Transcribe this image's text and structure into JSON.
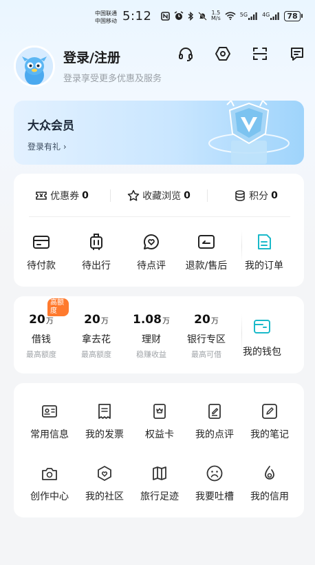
{
  "status_bar": {
    "carrier_1": "中国联通",
    "carrier_2": "中国移动",
    "time": "5:12",
    "net_speed_value": "1.5",
    "net_speed_unit": "M/s",
    "signal_1": "5G",
    "signal_2": "4G",
    "battery": "78"
  },
  "profile": {
    "title": "登录/注册",
    "subtitle": "登录享受更多优惠及服务"
  },
  "top_icons": [
    "headset-icon",
    "settings-hexagon-icon",
    "scan-icon",
    "message-icon"
  ],
  "member": {
    "title": "大众会员",
    "link": "登录有礼 ›"
  },
  "stats": [
    {
      "icon": "coupon-icon",
      "label": "优惠券",
      "count": "0"
    },
    {
      "icon": "star-icon",
      "label": "收藏浏览",
      "count": "0"
    },
    {
      "icon": "coins-icon",
      "label": "积分",
      "count": "0"
    }
  ],
  "orders": [
    {
      "icon": "wallet-card-icon",
      "label": "待付款"
    },
    {
      "icon": "luggage-icon",
      "label": "待出行"
    },
    {
      "icon": "review-heart-icon",
      "label": "待点评"
    },
    {
      "icon": "refund-icon",
      "label": "退款/售后"
    },
    {
      "icon": "order-doc-icon",
      "label": "我的订单"
    }
  ],
  "finance": {
    "badge": "高额度",
    "items": [
      {
        "amount": "20",
        "unit": "万",
        "name": "借钱",
        "sub": "最高额度"
      },
      {
        "amount": "20",
        "unit": "万",
        "name": "拿去花",
        "sub": "最高额度"
      },
      {
        "amount": "1.08",
        "unit": "万",
        "name": "理财",
        "sub": "稳赚收益"
      },
      {
        "amount": "20",
        "unit": "万",
        "name": "银行专区",
        "sub": "最高可借"
      }
    ],
    "wallet_label": "我的钱包"
  },
  "services": [
    {
      "icon": "id-card-icon",
      "label": "常用信息"
    },
    {
      "icon": "invoice-icon",
      "label": "我的发票"
    },
    {
      "icon": "benefit-card-icon",
      "label": "权益卡"
    },
    {
      "icon": "review-edit-icon",
      "label": "我的点评"
    },
    {
      "icon": "note-pen-icon",
      "label": "我的笔记"
    },
    {
      "icon": "camera-icon",
      "label": "创作中心"
    },
    {
      "icon": "community-icon",
      "label": "我的社区"
    },
    {
      "icon": "map-icon",
      "label": "旅行足迹"
    },
    {
      "icon": "sad-face-icon",
      "label": "我要吐槽"
    },
    {
      "icon": "credit-drop-icon",
      "label": "我的信用"
    }
  ],
  "colors": {
    "accent_teal": "#19b9c9",
    "badge_orange": "#ff7a2e",
    "icon_gray": "#333333"
  }
}
